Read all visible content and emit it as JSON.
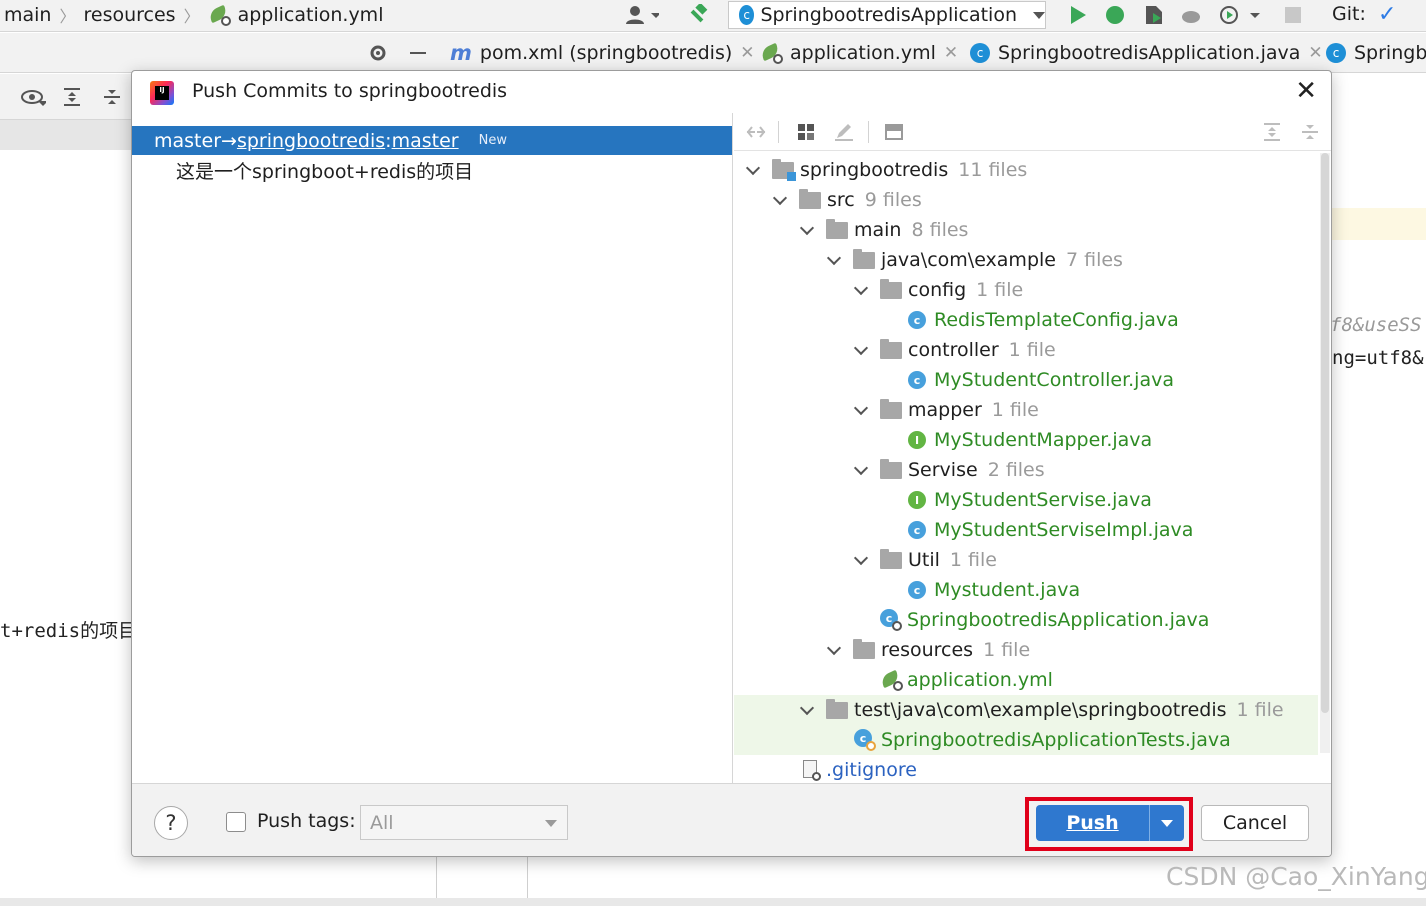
{
  "ide": {
    "breadcrumbs": [
      "main",
      "resources",
      "application.yml"
    ],
    "run_config": "SpringbootredisApplication",
    "git_label": "Git:",
    "editor_tabs": [
      {
        "label": "pom.xml (springbootredis)"
      },
      {
        "label": "application.yml"
      },
      {
        "label": "SpringbootredisApplication.java"
      },
      {
        "label": "Springb"
      }
    ],
    "bg_code_left": "t+redis的项目",
    "bg_code_right_1": "f8&useSS",
    "bg_code_right_2": "ng=utf8&"
  },
  "dialog": {
    "title": "Push Commits to springbootredis",
    "commit_branch": {
      "local": "master",
      "arrow": " → ",
      "remote": "springbootredis",
      "sep": " : ",
      "target": "master",
      "badge": "New"
    },
    "commit_message": "这是一个springboot+redis的项目",
    "tree": {
      "rows": [
        {
          "name": "springbootredis",
          "count": "11 files"
        },
        {
          "name": "src",
          "count": "9 files"
        },
        {
          "name": "main",
          "count": "8 files"
        },
        {
          "name": "java\\com\\example",
          "count": "7 files"
        },
        {
          "name": "config",
          "count": "1 file"
        },
        {
          "name": "RedisTemplateConfig.java"
        },
        {
          "name": "controller",
          "count": "1 file"
        },
        {
          "name": "MyStudentController.java"
        },
        {
          "name": "mapper",
          "count": "1 file"
        },
        {
          "name": "MyStudentMapper.java"
        },
        {
          "name": "Servise",
          "count": "2 files"
        },
        {
          "name": "MyStudentServise.java"
        },
        {
          "name": "MyStudentServiseImpl.java"
        },
        {
          "name": "Util",
          "count": "1 file"
        },
        {
          "name": "Mystudent.java"
        },
        {
          "name": "SpringbootredisApplication.java"
        },
        {
          "name": "resources",
          "count": "1 file"
        },
        {
          "name": "application.yml"
        },
        {
          "name": "test\\java\\com\\example\\springbootredis",
          "count": "1 file"
        },
        {
          "name": "SpringbootredisApplicationTests.java"
        },
        {
          "name": ".gitignore"
        }
      ]
    },
    "footer": {
      "help_label": "?",
      "push_tags_label": "Push tags:",
      "push_tags_value": "All",
      "push_label": "Push",
      "cancel_label": "Cancel"
    }
  },
  "watermark": "CSDN @Cao_XinYang",
  "colors": {
    "selection": "#2675bf",
    "push_button": "#2f78cf",
    "highlight_box": "#e0001a",
    "file_added": "#2e8b24",
    "file_other": "#2b62c0"
  }
}
